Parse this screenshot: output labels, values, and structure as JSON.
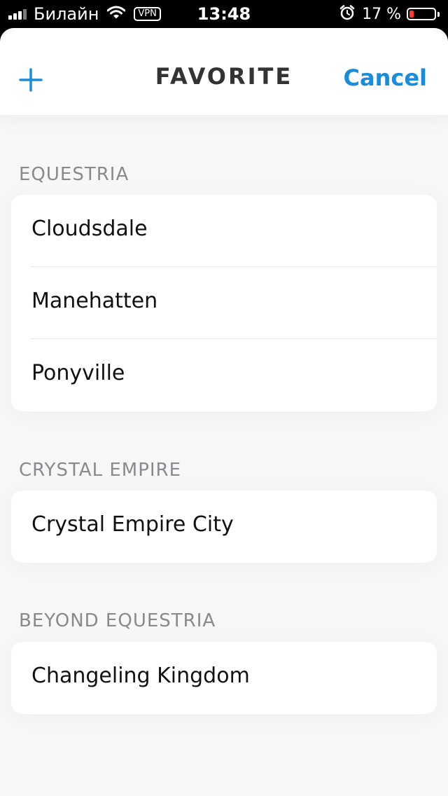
{
  "status_bar": {
    "carrier": "Билайн",
    "vpn": "VPN",
    "time": "13:48",
    "battery_percent": "17 %",
    "battery_level": 0.17,
    "icons": [
      "signal-icon",
      "wifi-icon",
      "alarm-icon",
      "battery-icon"
    ]
  },
  "nav": {
    "add_icon": "plus-icon",
    "title": "FAVORITE",
    "cancel_label": "Cancel"
  },
  "colors": {
    "accent": "#1a8cdc",
    "battery_low": "#ff3b30",
    "background": "#f7f7f8",
    "section_header": "#8a8a8e"
  },
  "sections": [
    {
      "title": "EQUESTRIA",
      "items": [
        "Cloudsdale",
        "Manehatten",
        "Ponyville"
      ]
    },
    {
      "title": "CRYSTAL EMPIRE",
      "items": [
        "Crystal Empire City"
      ]
    },
    {
      "title": "BEYOND EQUESTRIA",
      "items": [
        "Changeling Kingdom"
      ]
    }
  ]
}
